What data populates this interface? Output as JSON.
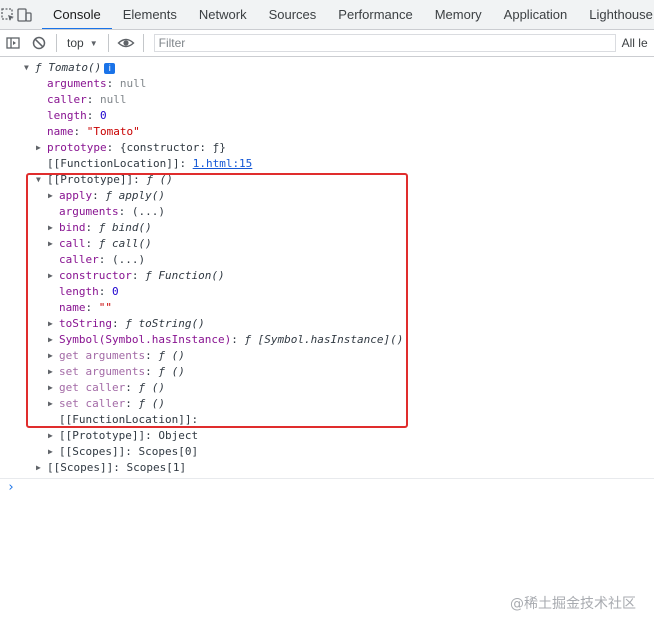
{
  "tabs": [
    "Console",
    "Elements",
    "Network",
    "Sources",
    "Performance",
    "Memory",
    "Application",
    "Lighthouse"
  ],
  "active_tab": "Console",
  "toolbar": {
    "context": "top",
    "filter_placeholder": "Filter",
    "levels": "All le"
  },
  "icons": {
    "inspect": "inspect-element-icon",
    "device": "device-toolbar-icon",
    "sidebar": "sidebar-toggle-icon",
    "clear": "clear-console-icon",
    "eye": "live-expression-eye-icon",
    "info": "info-icon"
  },
  "highlight_color": "#e02d2d",
  "tree": [
    {
      "indent": 0,
      "toggle": "expanded",
      "key": "",
      "glyph": "ƒ",
      "value": "Tomato()",
      "info": true
    },
    {
      "indent": 1,
      "toggle": "none",
      "key": "arguments",
      "value": "null",
      "vtype": "null"
    },
    {
      "indent": 1,
      "toggle": "none",
      "key": "caller",
      "value": "null",
      "vtype": "null"
    },
    {
      "indent": 1,
      "toggle": "none",
      "key": "length",
      "value": "0",
      "vtype": "num"
    },
    {
      "indent": 1,
      "toggle": "none",
      "key": "name",
      "value": "\"Tomato\"",
      "vtype": "str"
    },
    {
      "indent": 1,
      "toggle": "collapsed",
      "key": "prototype",
      "value": "{constructor: ƒ}",
      "vtype": "plain"
    },
    {
      "indent": 1,
      "toggle": "none",
      "key": "[[FunctionLocation]]",
      "value": "1.html:15",
      "vtype": "link",
      "kstyle": "plain"
    },
    {
      "indent": 1,
      "toggle": "expanded",
      "key": "[[Prototype]]",
      "value": "ƒ ()",
      "vtype": "fn",
      "kstyle": "plain"
    },
    {
      "indent": 2,
      "toggle": "collapsed",
      "key": "apply",
      "value": "ƒ apply()",
      "vtype": "fn"
    },
    {
      "indent": 2,
      "toggle": "none",
      "key": "arguments",
      "value": "(...)",
      "vtype": "plain"
    },
    {
      "indent": 2,
      "toggle": "collapsed",
      "key": "bind",
      "value": "ƒ bind()",
      "vtype": "fn"
    },
    {
      "indent": 2,
      "toggle": "collapsed",
      "key": "call",
      "value": "ƒ call()",
      "vtype": "fn"
    },
    {
      "indent": 2,
      "toggle": "none",
      "key": "caller",
      "value": "(...)",
      "vtype": "plain"
    },
    {
      "indent": 2,
      "toggle": "collapsed",
      "key": "constructor",
      "value": "ƒ Function()",
      "vtype": "fn"
    },
    {
      "indent": 2,
      "toggle": "none",
      "key": "length",
      "value": "0",
      "vtype": "num"
    },
    {
      "indent": 2,
      "toggle": "none",
      "key": "name",
      "value": "\"\"",
      "vtype": "str"
    },
    {
      "indent": 2,
      "toggle": "collapsed",
      "key": "toString",
      "value": "ƒ toString()",
      "vtype": "fn"
    },
    {
      "indent": 2,
      "toggle": "collapsed",
      "key": "Symbol(Symbol.hasInstance)",
      "value": "ƒ [Symbol.hasInstance]()",
      "vtype": "fn"
    },
    {
      "indent": 2,
      "toggle": "collapsed",
      "key": "get arguments",
      "value": "ƒ ()",
      "vtype": "fn",
      "kstyle": "dim"
    },
    {
      "indent": 2,
      "toggle": "collapsed",
      "key": "set arguments",
      "value": "ƒ ()",
      "vtype": "fn",
      "kstyle": "dim"
    },
    {
      "indent": 2,
      "toggle": "collapsed",
      "key": "get caller",
      "value": "ƒ ()",
      "vtype": "fn",
      "kstyle": "dim"
    },
    {
      "indent": 2,
      "toggle": "collapsed",
      "key": "set caller",
      "value": "ƒ ()",
      "vtype": "fn",
      "kstyle": "dim"
    },
    {
      "indent": 2,
      "toggle": "none",
      "key": "[[FunctionLocation]]",
      "value": "",
      "vtype": "plain",
      "kstyle": "plain"
    },
    {
      "indent": 2,
      "toggle": "collapsed",
      "key": "[[Prototype]]",
      "value": "Object",
      "vtype": "plain",
      "kstyle": "plain"
    },
    {
      "indent": 2,
      "toggle": "collapsed",
      "key": "[[Scopes]]",
      "value": "Scopes[0]",
      "vtype": "plain",
      "kstyle": "plain"
    },
    {
      "indent": 1,
      "toggle": "collapsed",
      "key": "[[Scopes]]",
      "value": "Scopes[1]",
      "vtype": "plain",
      "kstyle": "plain"
    }
  ],
  "prompt": "›",
  "watermark": "@稀土掘金技术社区"
}
